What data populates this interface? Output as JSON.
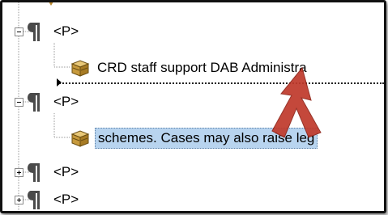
{
  "tree": {
    "nodes": [
      {
        "kind": "element",
        "tag": "<P>",
        "state": "expanded"
      },
      {
        "kind": "text",
        "text": "CRD staff support DAB Administra"
      },
      {
        "kind": "element",
        "tag": "<P>",
        "state": "expanded"
      },
      {
        "kind": "text",
        "text": "schemes.  Cases may also raise leg",
        "selected": true
      },
      {
        "kind": "element",
        "tag": "<P>",
        "state": "collapsed"
      },
      {
        "kind": "element",
        "tag": "<P>",
        "state": "collapsed"
      }
    ],
    "expanded_symbol": "⊟",
    "collapsed_symbol": "⊞"
  },
  "colors": {
    "selection": "#b8d4ef",
    "arrow": "#c0392b",
    "frame": "#111111"
  },
  "icons": {
    "pilcrow": "pilcrow-icon",
    "text_node": "text-box-icon",
    "drag_arrow": "drag-arrow-icon"
  }
}
